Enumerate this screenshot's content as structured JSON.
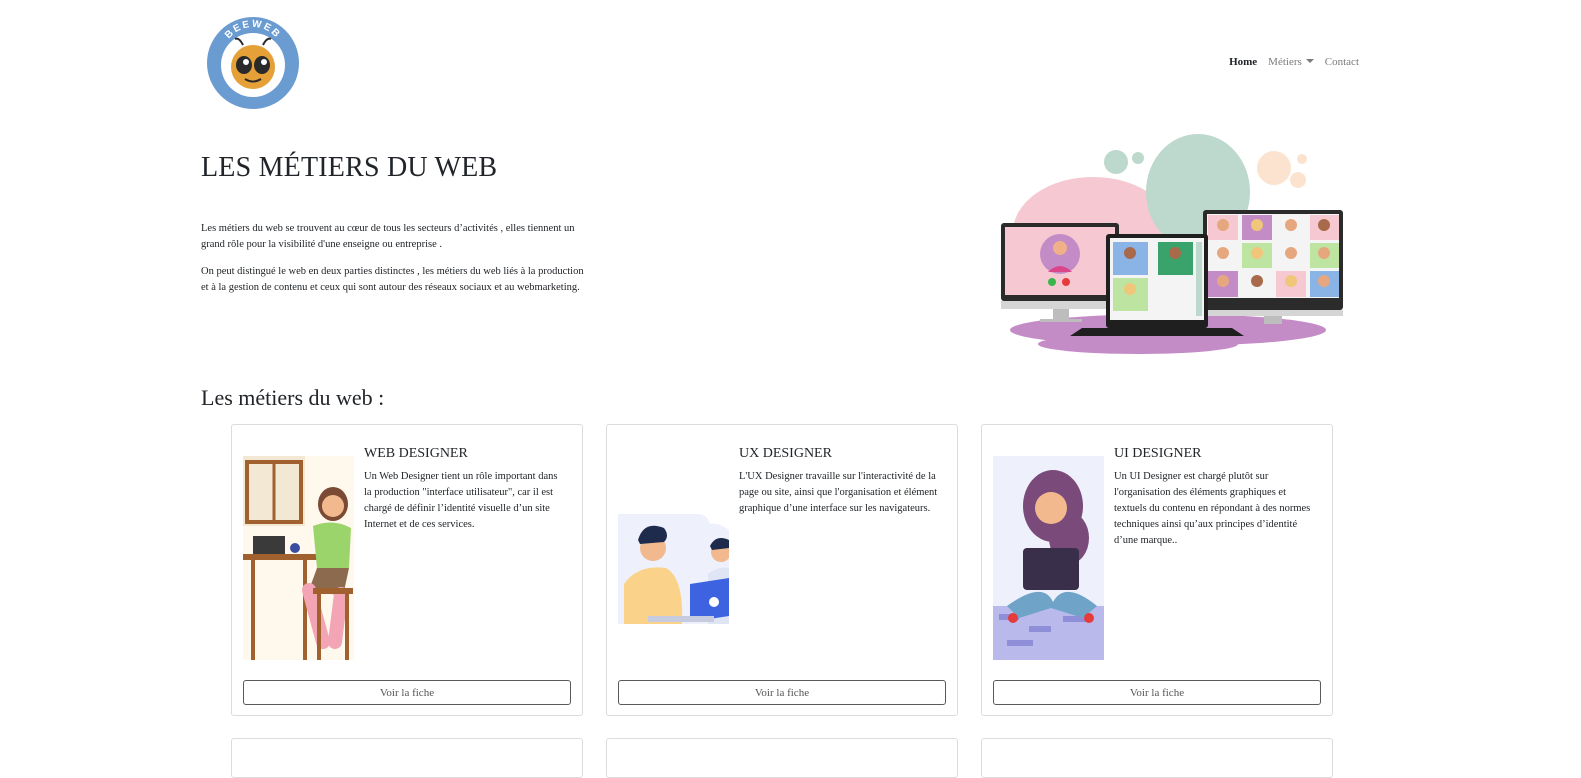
{
  "brand": {
    "logo_text": "BEEWEB"
  },
  "nav": {
    "items": [
      {
        "label": "Home"
      },
      {
        "label": "Métiers"
      },
      {
        "label": "Contact"
      }
    ]
  },
  "hero": {
    "title": "LES MÉTIERS DU WEB",
    "paragraphs": [
      "Les métiers du web se trouvent au cœur de tous les secteurs d’activités , elles tiennent un grand rôle pour la visibilité d'une enseigne ou entreprise .",
      "On peut distingué le web en deux parties distinctes , les métiers du web liés à la production et à la gestion de contenu et ceux qui sont autour des réseaux sociaux et au webmarketing."
    ]
  },
  "section": {
    "title": "Les métiers du web :"
  },
  "cards": [
    {
      "title": "WEB DESIGNER",
      "text": "Un Web Designer tient un rôle important dans la production \"interface utilisateur\", car il est chargé de définir l’identité visuelle d’un site Internet et de ces services.",
      "button": "Voir la fiche"
    },
    {
      "title": "UX DESIGNER",
      "text": "L'UX Designer travaille sur l'interactivité de la page ou site, ainsi que l'organisation et élément graphique d’une interface sur les navigateurs.",
      "button": "Voir la fiche"
    },
    {
      "title": "UI DESIGNER",
      "text": "Un UI Designer est chargé plutôt sur l'organisation des éléments graphiques et textuels du contenu en répondant à des normes techniques ainsi qu’aux principes d’identité d’une marque..",
      "button": "Voir la fiche"
    }
  ],
  "colors": {
    "logo_blue": "#6a9bd1",
    "pink": "#f6c9d2",
    "mint": "#bdd8cc",
    "purple": "#c48cc7",
    "button_border": "#5a5a5a",
    "card_border": "#dcdcdc"
  }
}
